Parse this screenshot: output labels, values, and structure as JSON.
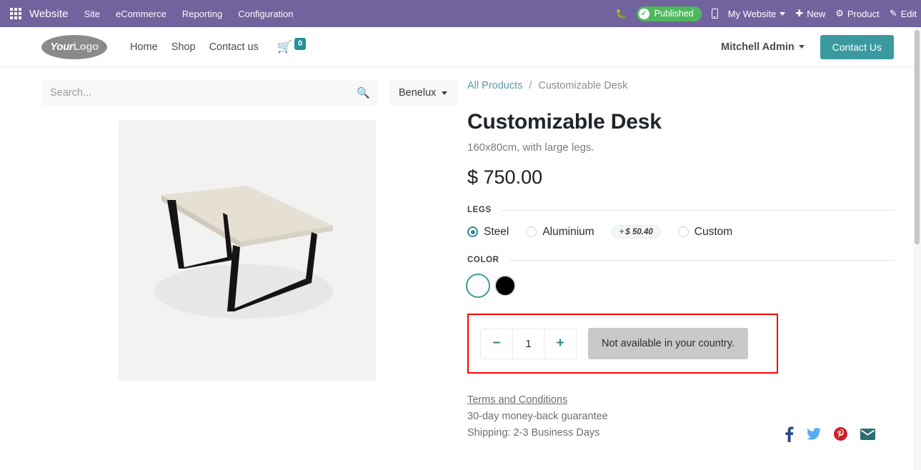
{
  "topbar": {
    "apps_icon": "apps-grid-icon",
    "brand": "Website",
    "menu": [
      "Site",
      "eCommerce",
      "Reporting",
      "Configuration"
    ],
    "bug_icon": "bug-icon",
    "publish_label": "Published",
    "publish_check_icon": "check-circle-icon",
    "mobile_icon": "mobile-preview-icon",
    "website_selector": "My Website",
    "new_label": "New",
    "new_icon": "plus-icon",
    "product_label": "Product",
    "product_icon": "gear-icon",
    "edit_label": "Edit",
    "edit_icon": "pencil-icon",
    "bg_color": "#71639e",
    "publish_color": "#4eb85d"
  },
  "header": {
    "logo_first": "Your",
    "logo_second": "Logo",
    "nav": [
      "Home",
      "Shop",
      "Contact us"
    ],
    "cart_icon": "shopping-cart-icon",
    "cart_count": "0",
    "cart_badge_color": "#27909a",
    "user_name": "Mitchell Admin",
    "contact_button": "Contact Us",
    "accent_color": "#3a9aa0"
  },
  "search": {
    "placeholder": "Search...",
    "value": "",
    "icon": "search-icon",
    "pricelist": "Benelux"
  },
  "breadcrumb": {
    "root": "All Products",
    "separator": "/",
    "current": "Customizable Desk"
  },
  "product": {
    "image_alt": "customizable-desk-photo",
    "title": "Customizable Desk",
    "subtitle": "160x80cm, with large legs.",
    "price": "$ 750.00",
    "attributes": [
      {
        "name": "LEGS",
        "type": "radio",
        "options": [
          {
            "label": "Steel",
            "selected": true,
            "extra": null
          },
          {
            "label": "Aluminium",
            "selected": false,
            "extra": "$ 50.40",
            "extra_sign": "+"
          },
          {
            "label": "Custom",
            "selected": false,
            "extra": null
          }
        ]
      },
      {
        "name": "COLOR",
        "type": "swatch",
        "options": [
          {
            "label": "White",
            "color": "#ffffff",
            "selected": true
          },
          {
            "label": "Black",
            "color": "#000000",
            "selected": false
          }
        ]
      }
    ],
    "quantity": "1",
    "decrease_icon": "minus-icon",
    "increase_icon": "plus-icon",
    "unavailable_label": "Not available in your country.",
    "highlight_color": "#ff0000"
  },
  "footer_info": {
    "terms_link": "Terms and Conditions",
    "guarantee": "30-day money-back guarantee",
    "shipping": "Shipping: 2-3 Business Days",
    "socials": [
      {
        "name": "facebook-icon",
        "glyph": "f",
        "color": "#2b4a8b"
      },
      {
        "name": "twitter-icon",
        "glyph": "t",
        "color": "#55acee"
      },
      {
        "name": "pinterest-icon",
        "glyph": "P",
        "color": "#cb2027"
      },
      {
        "name": "email-icon",
        "glyph": "m",
        "color": "#2d6f6f"
      }
    ]
  }
}
